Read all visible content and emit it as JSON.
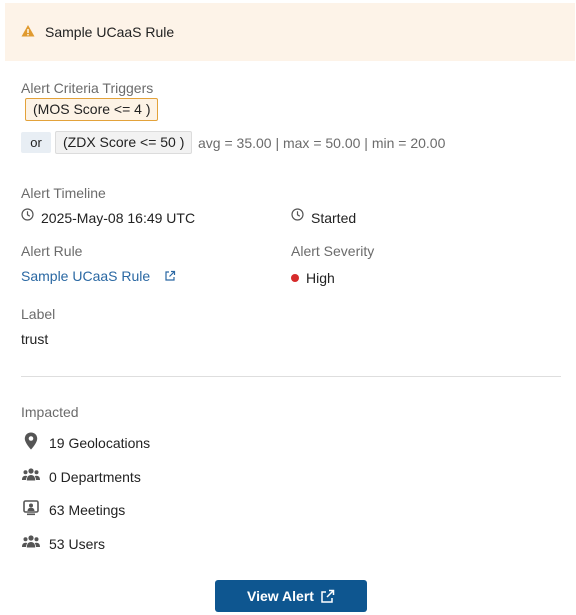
{
  "header": {
    "title": "Sample UCaaS Rule",
    "icon": "warning-icon",
    "accent": "#e09a2f"
  },
  "criteria": {
    "label": "Alert Criteria Triggers",
    "trigger1": "(MOS Score <= 4 )",
    "or_label": "or",
    "trigger2": "(ZDX Score <= 50 )",
    "stats": "avg = 35.00 | max = 50.00 | min = 20.00"
  },
  "timeline": {
    "label": "Alert Timeline",
    "date": "2025-May-08 16:49 UTC",
    "status": "Started"
  },
  "rule": {
    "label": "Alert Rule",
    "name": "Sample UCaaS Rule"
  },
  "severity": {
    "label": "Alert Severity",
    "value": "High",
    "color": "#d62b2b"
  },
  "tag": {
    "label": "Label",
    "value": "trust"
  },
  "impacted": {
    "label": "Impacted",
    "geolocations": "19 Geolocations",
    "departments": "0 Departments",
    "meetings": "63 Meetings",
    "users": "53 Users"
  },
  "actions": {
    "view_alert": "View Alert"
  }
}
